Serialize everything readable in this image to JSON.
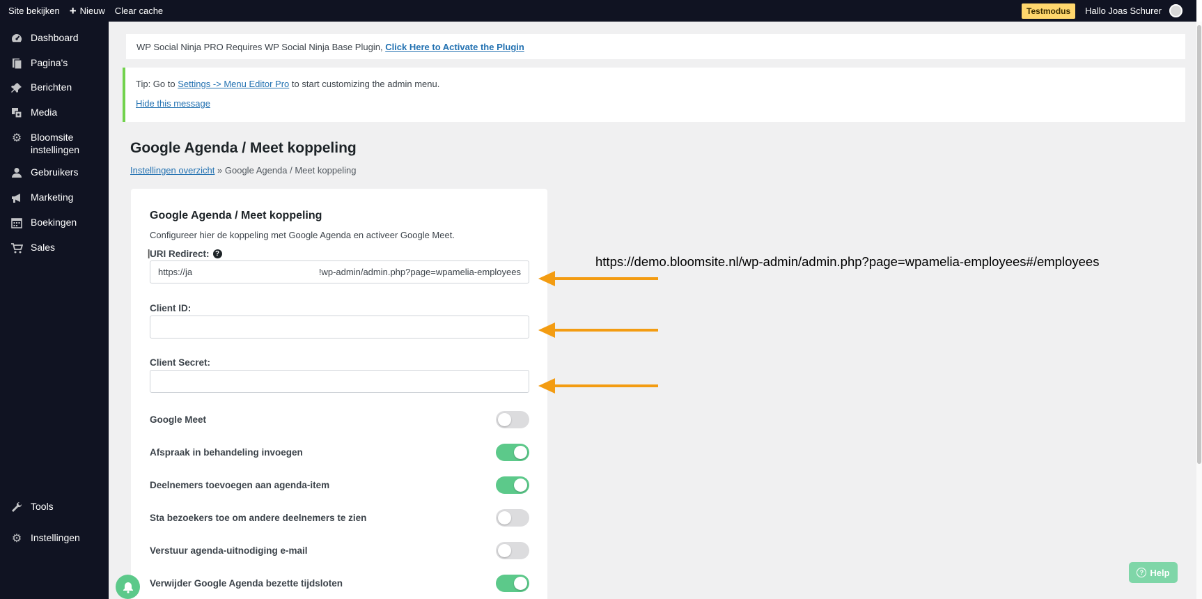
{
  "adminbar": {
    "site_label": "Site bekijken",
    "new_label": "Nieuw",
    "cache_label": "Clear cache",
    "mode_badge": "Testmodus",
    "greeting": "Hallo Joas Schurer"
  },
  "sidebar": {
    "items": [
      {
        "label": "Dashboard",
        "icon": "dashboard-icon"
      },
      {
        "label": "Pagina's",
        "icon": "pages-icon"
      },
      {
        "label": "Berichten",
        "icon": "pin-icon"
      },
      {
        "label": "Media",
        "icon": "media-icon"
      },
      {
        "label": "Bloomsite instellingen",
        "icon": "gear-icon"
      },
      {
        "label": "Gebruikers",
        "icon": "user-icon"
      },
      {
        "label": "Marketing",
        "icon": "megaphone-icon"
      },
      {
        "label": "Boekingen",
        "icon": "calendar-icon"
      },
      {
        "label": "Sales",
        "icon": "cart-icon"
      },
      {
        "label": "Tools",
        "icon": "wrench-icon"
      },
      {
        "label": "Instellingen",
        "icon": "gear-icon"
      }
    ]
  },
  "notices": {
    "plugin_text": "WP Social Ninja PRO Requires WP Social Ninja Base Plugin,",
    "plugin_link": "Click Here to Activate the Plugin",
    "tip_prefix": "Tip: Go to",
    "tip_link": "Settings -> Menu Editor Pro",
    "tip_suffix": "to start customizing the admin menu.",
    "hide_link": "Hide this message"
  },
  "page": {
    "title": "Google Agenda / Meet koppeling",
    "breadcrumb_link": "Instellingen overzicht",
    "breadcrumb_current": "» Google Agenda / Meet koppeling"
  },
  "card": {
    "title": "Google Agenda / Meet koppeling",
    "description": "Configureer hier de koppeling met Google Agenda en activeer Google Meet.",
    "uri_label": "URI Redirect:",
    "uri_value_start": "https://ja",
    "uri_value_end": "!wp-admin/admin.php?page=wpamelia-employees",
    "client_id_label": "Client ID:",
    "client_id_value": "",
    "client_secret_label": "Client Secret:",
    "client_secret_value": "",
    "toggles": [
      {
        "label": "Google Meet",
        "on": false
      },
      {
        "label": "Afspraak in behandeling invoegen",
        "on": true
      },
      {
        "label": "Deelnemers toevoegen aan agenda-item",
        "on": true
      },
      {
        "label": "Sta bezoekers toe om andere deelnemers te zien",
        "on": false
      },
      {
        "label": "Verstuur agenda-uitnodiging e-mail",
        "on": false
      },
      {
        "label": "Verwijder Google Agenda bezette tijdsloten",
        "on": true
      }
    ]
  },
  "annotation": {
    "url": "https://demo.bloomsite.nl/wp-admin/admin.php?page=wpamelia-employees#/employees",
    "arrow_color": "#f39c12"
  },
  "help_button": "Help"
}
